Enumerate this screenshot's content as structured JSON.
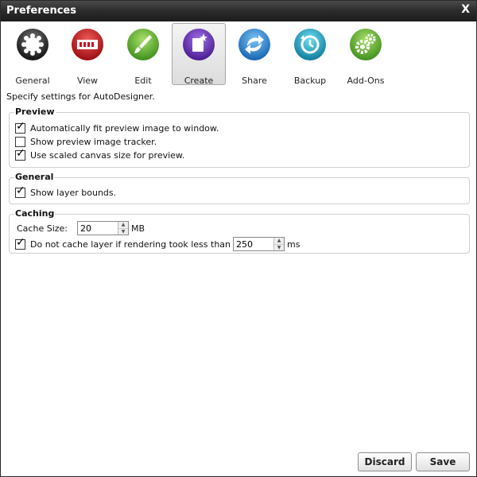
{
  "window": {
    "title": "Preferences",
    "close_label": "X"
  },
  "toolbar": {
    "items": [
      {
        "label": "General",
        "icon": "gear-flower-icon",
        "color": "#2a2a2a",
        "active": false
      },
      {
        "label": "View",
        "icon": "film-strip-icon",
        "color": "#c8141c",
        "active": false
      },
      {
        "label": "Edit",
        "icon": "brush-icon",
        "color": "#6fb52c",
        "active": false
      },
      {
        "label": "Create",
        "icon": "new-document-icon",
        "color": "#6a2fb8",
        "active": true
      },
      {
        "label": "Share",
        "icon": "share-arrows-icon",
        "color": "#2c86d4",
        "active": false
      },
      {
        "label": "Backup",
        "icon": "backup-clock-icon",
        "color": "#1fa3c4",
        "active": false
      },
      {
        "label": "Add-Ons",
        "icon": "gears-icon",
        "color": "#6fb52c",
        "active": false
      }
    ]
  },
  "description": "Specify settings for AutoDesigner.",
  "groups": {
    "preview": {
      "title": "Preview",
      "options": [
        {
          "label": "Automatically fit preview image to window.",
          "checked": true
        },
        {
          "label": "Show preview image tracker.",
          "checked": false
        },
        {
          "label": "Use scaled canvas size for preview.",
          "checked": true
        }
      ]
    },
    "general": {
      "title": "General",
      "options": [
        {
          "label": "Show layer bounds.",
          "checked": true
        }
      ]
    },
    "caching": {
      "title": "Caching",
      "cache_size_label": "Cache Size:",
      "cache_size_value": "20",
      "cache_size_unit": "MB",
      "no_cache_label": "Do not cache layer if rendering took less than",
      "no_cache_checked": true,
      "no_cache_value": "250",
      "no_cache_unit": "ms"
    }
  },
  "buttons": {
    "discard": "Discard",
    "save": "Save"
  }
}
